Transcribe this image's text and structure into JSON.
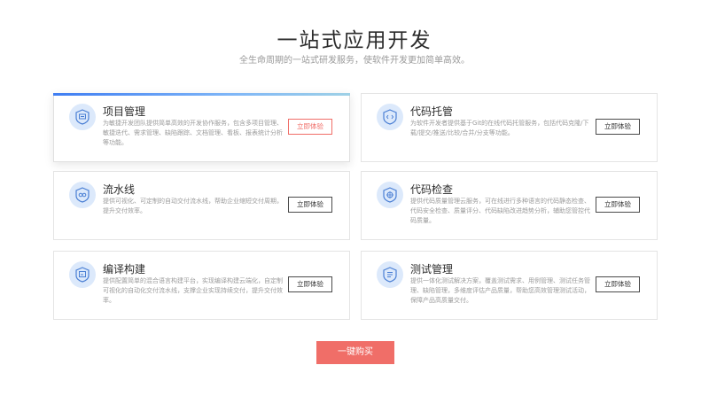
{
  "header": {
    "title": "一站式应用开发",
    "subtitle": "全生命周期的一站式研发服务，使软件开发更加简单高效。"
  },
  "colors": {
    "accent": "#f06e68",
    "icon_bg": "#dce9fb",
    "icon_fg": "#4a7fd4",
    "active_bar": "#3f7df2"
  },
  "cards": [
    {
      "title": "项目管理",
      "icon": "project-board-icon",
      "description": "为敏捷开发团队提供简单高效的开发协作服务，包含多项目管理、敏捷迭代、需求管理、缺陷跟踪、文档管理、看板、报表统计分析等功能。",
      "button": "立即体验",
      "active": true
    },
    {
      "title": "代码托管",
      "icon": "code-shield-icon",
      "description": "为软件开发者提供基于Git的在线代码托管服务，包括代码克隆/下载/提交/推送/比较/合并/分支等功能。",
      "button": "立即体验",
      "active": false
    },
    {
      "title": "流水线",
      "icon": "pipeline-icon",
      "description": "提供可视化、可定制的自动交付流水线，帮助企业缩短交付周期，提升交付效率。",
      "button": "立即体验",
      "active": false
    },
    {
      "title": "代码检查",
      "icon": "code-check-icon",
      "description": "提供代码质量管理云服务，可在线进行多种语言的代码静态检查、代码安全检查、质量评分、代码缺陷改进趋势分析，辅助您管控代码质量。",
      "button": "立即体验",
      "active": false
    },
    {
      "title": "编译构建",
      "icon": "build-monitor-icon",
      "description": "提供配置简单的混合语言构建平台，实现编译构建云端化，自定制可视化的自动化交付流水线，支撑企业实现持续交付，提升交付效率。",
      "button": "立即体验",
      "active": false
    },
    {
      "title": "测试管理",
      "icon": "test-list-icon",
      "description": "提供一体化测试解决方案，覆盖测试需求、用例管理、测试任务管理、缺陷管理，多维度评估产品质量，帮助您高效管理测试活动，保障产品高质量交付。",
      "button": "立即体验",
      "active": false
    }
  ],
  "buy_button": "一键购买"
}
